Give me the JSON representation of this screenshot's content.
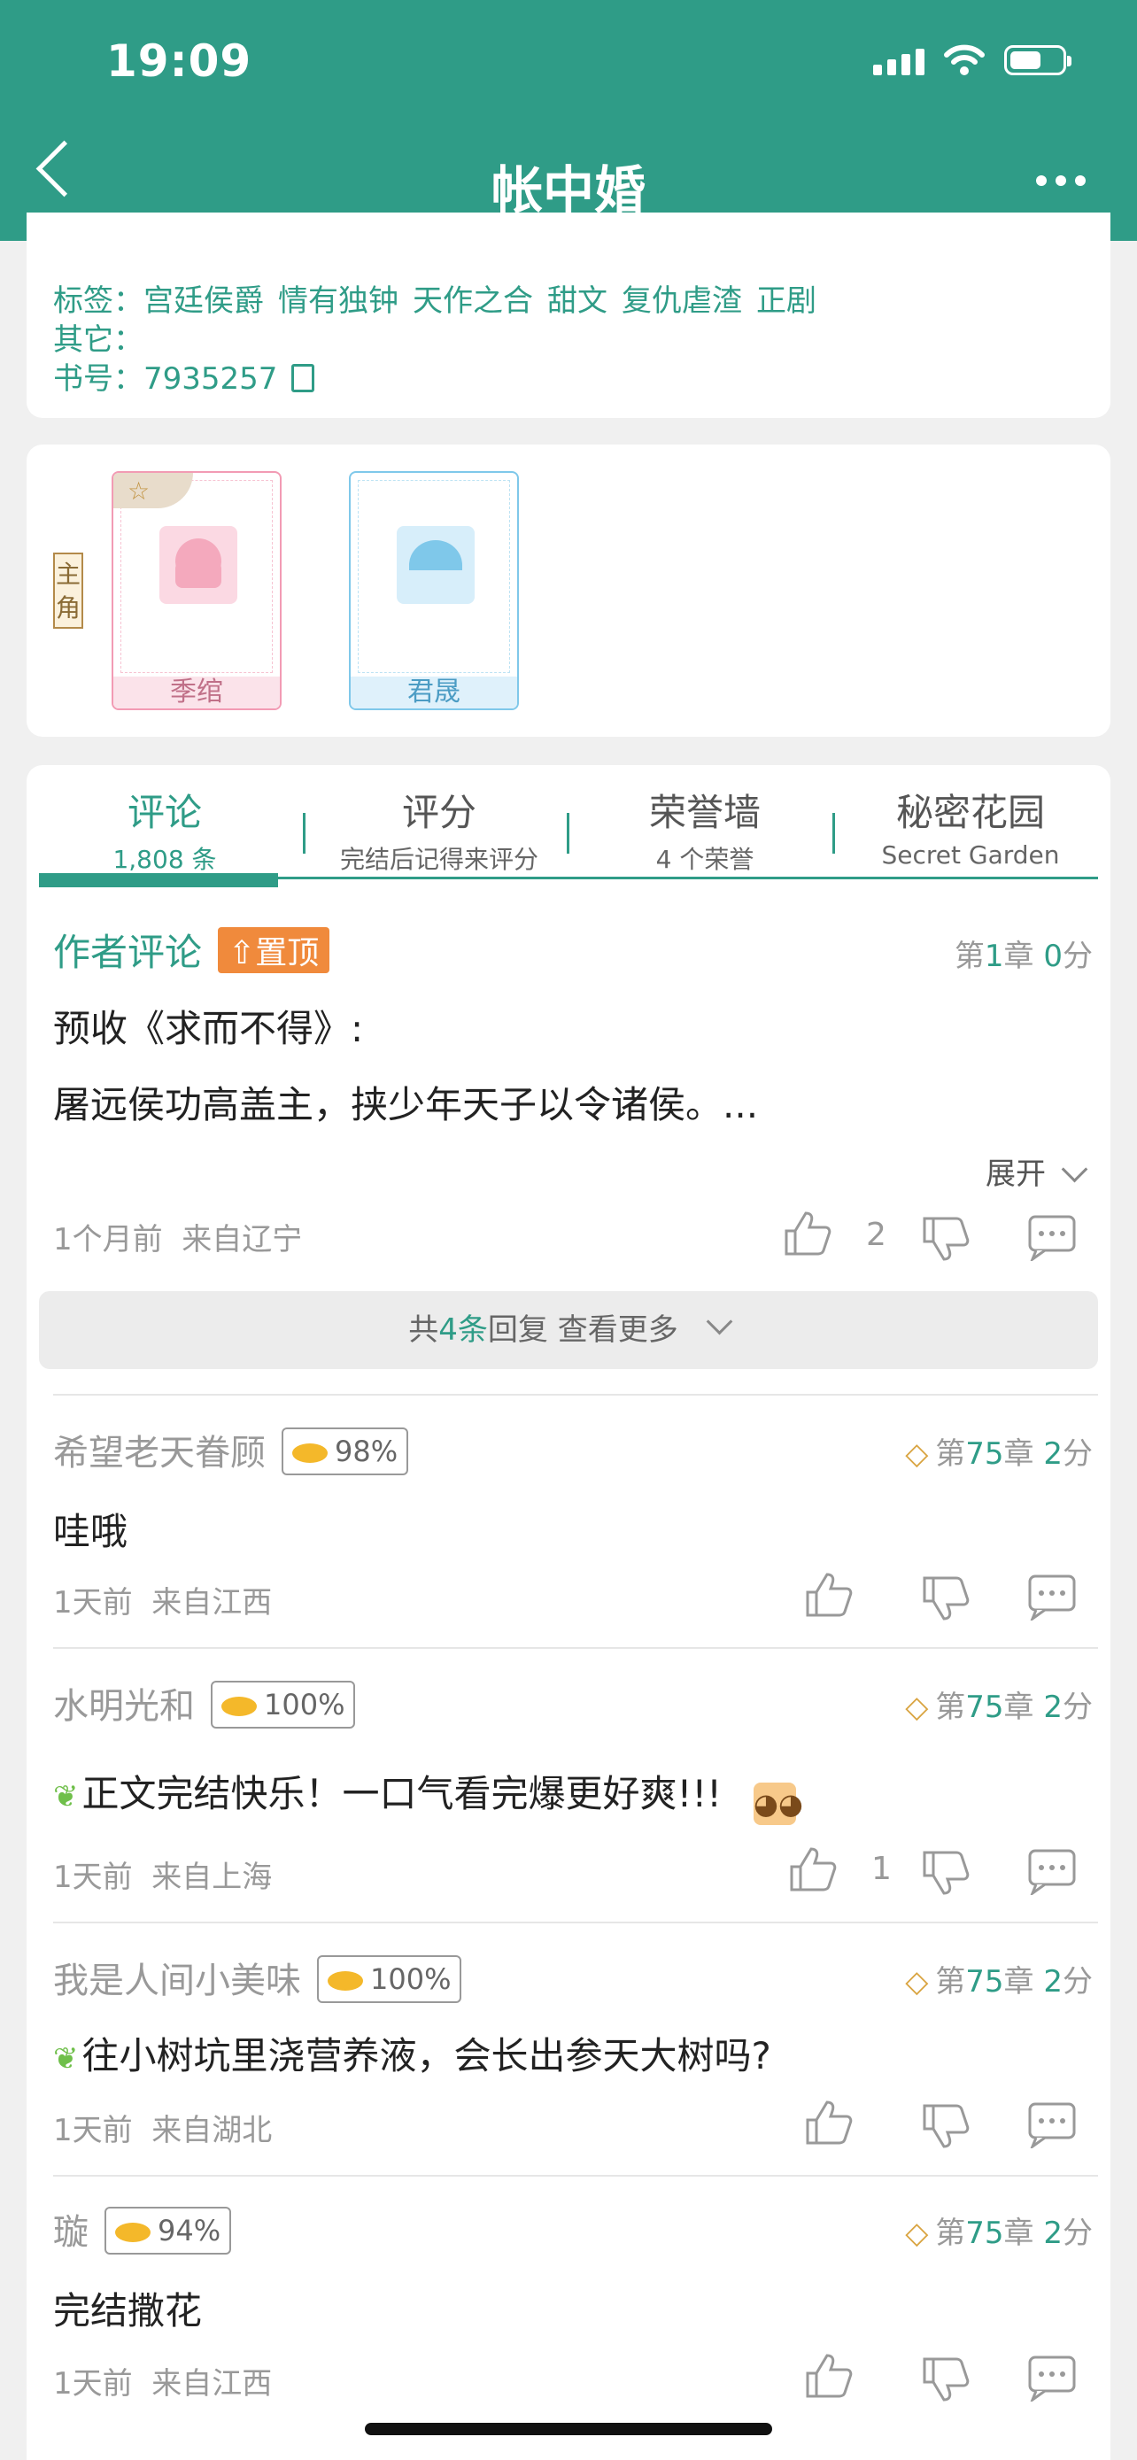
{
  "status_bar": {
    "time": "19:09"
  },
  "nav": {
    "title": "帐中婚"
  },
  "info": {
    "tags_label": "标签：",
    "tags": [
      "宫廷侯爵",
      "情有独钟",
      "天作之合",
      "甜文",
      "复仇虐渣",
      "正剧"
    ],
    "other_label": "其它：",
    "book_no_label": "书号：",
    "book_no": "7935257"
  },
  "characters": {
    "role_tag": "主角",
    "items": [
      {
        "name": "季绾",
        "color": "#f29bb4"
      },
      {
        "name": "君晟",
        "color": "#7fc8ea"
      }
    ]
  },
  "tabs": [
    {
      "title": "评论",
      "sub": "1,808 条"
    },
    {
      "title": "评分",
      "sub": "完结后记得来评分"
    },
    {
      "title": "荣誉墙",
      "sub": "4 个荣誉"
    },
    {
      "title": "秘密花园",
      "sub": "Secret Garden"
    }
  ],
  "author_comment": {
    "title": "作者评论",
    "pin": "置顶",
    "chapter_prefix": "第",
    "chapter": "1",
    "chapter_mid": "章",
    "score": "0",
    "score_suffix": "分",
    "line1": "预收《求而不得》:",
    "line2": "屠远侯功高盖主，挟少年天子以令诸侯。...",
    "expand": "展开",
    "time": "1个月前",
    "location": "来自辽宁",
    "likes": "2",
    "reply_prefix": "共",
    "reply_count": "4条",
    "reply_suffix": "回复 查看更多"
  },
  "comments": [
    {
      "user": "希望老天眷顾",
      "badge": "98%",
      "chapter": "75",
      "score": "2",
      "text": "哇哦",
      "time": "1天前",
      "location": "来自江西",
      "likes": ""
    },
    {
      "user": "水明光和",
      "badge": "100%",
      "chapter": "75",
      "score": "2",
      "text": "正文完结快乐！一口气看完爆更好爽!!!",
      "time": "1天前",
      "location": "来自上海",
      "likes": "1"
    },
    {
      "user": "我是人间小美味",
      "badge": "100%",
      "chapter": "75",
      "score": "2",
      "text": "往小树坑里浇营养液，会长出参天大树吗?",
      "time": "1天前",
      "location": "来自湖北",
      "likes": ""
    },
    {
      "user": "璇",
      "badge": "94%",
      "chapter": "75",
      "score": "2",
      "text": "完结撒花",
      "time": "1天前",
      "location": "来自江西",
      "likes": ""
    }
  ],
  "labels": {
    "chapter_prefix": "第",
    "chapter_mid": "章",
    "score_suffix": "分"
  },
  "colors": {
    "primary": "#2f9c87",
    "pin": "#f08a3c",
    "gold": "#f4b82a"
  }
}
